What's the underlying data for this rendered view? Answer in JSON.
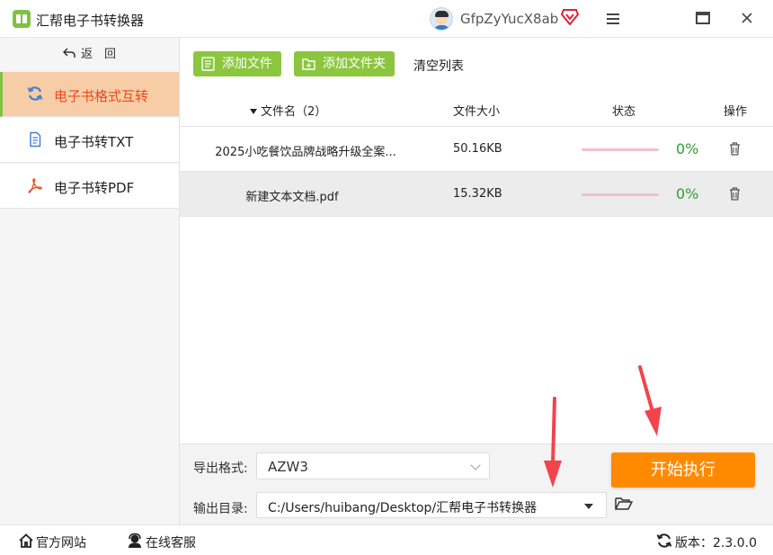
{
  "window": {
    "title": "汇帮电子书转换器",
    "username": "GfpZyYucX8ab"
  },
  "sidebar": {
    "back_label": "返　回",
    "items": [
      {
        "label": "电子书格式互转",
        "active": true,
        "icon": "refresh-icon"
      },
      {
        "label": "电子书转TXT",
        "active": false,
        "icon": "txt-doc-icon"
      },
      {
        "label": "电子书转PDF",
        "active": false,
        "icon": "pdf-icon"
      }
    ]
  },
  "toolbar": {
    "add_file": "添加文件",
    "add_folder": "添加文件夹",
    "clear_list": "清空列表"
  },
  "table": {
    "headers": {
      "name": "文件名（2）",
      "size": "文件大小",
      "status": "状态",
      "action": "操作"
    },
    "rows": [
      {
        "name": "2025小吃餐饮品牌战略升级全案...",
        "size": "50.16KB",
        "progress": 0,
        "percent": "0%"
      },
      {
        "name": "新建文本文档.pdf",
        "size": "15.32KB",
        "progress": 0,
        "percent": "0%"
      }
    ]
  },
  "settings": {
    "format_label": "导出格式:",
    "format_value": "AZW3",
    "dir_label": "输出目录:",
    "dir_value": "C:/Users/huibang/Desktop/汇帮电子书转换器",
    "start_label": "开始执行"
  },
  "statusbar": {
    "website": "官方网站",
    "support": "在线客服",
    "version": "版本：2.3.0.0"
  },
  "colors": {
    "accent_green": "#8cc63f",
    "active_bg": "#f7cda7",
    "active_text": "#ea4a1c",
    "start_orange": "#ff8a00",
    "percent_green": "#2ea02e"
  }
}
